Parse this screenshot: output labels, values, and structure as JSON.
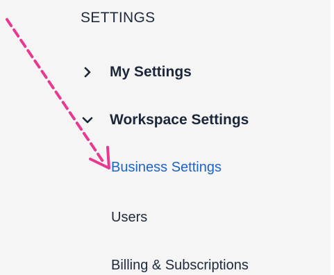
{
  "sidebar": {
    "heading": "SETTINGS",
    "groups": [
      {
        "label": "My Settings",
        "expanded": false,
        "icon": "chevron-right-icon"
      },
      {
        "label": "Workspace Settings",
        "expanded": true,
        "icon": "chevron-down-icon"
      }
    ],
    "subitems": [
      {
        "label": "Business Settings",
        "active": true
      },
      {
        "label": "Users",
        "active": false
      },
      {
        "label": "Billing & Subscriptions",
        "active": false
      }
    ]
  },
  "colors": {
    "background": "#f5f5f6",
    "text_dark": "#1b2638",
    "active_link": "#1c63c9",
    "annotation_arrow": "#e8388f"
  },
  "annotation": {
    "icon": "dashed-arrow-icon",
    "points_to": "Business Settings"
  }
}
